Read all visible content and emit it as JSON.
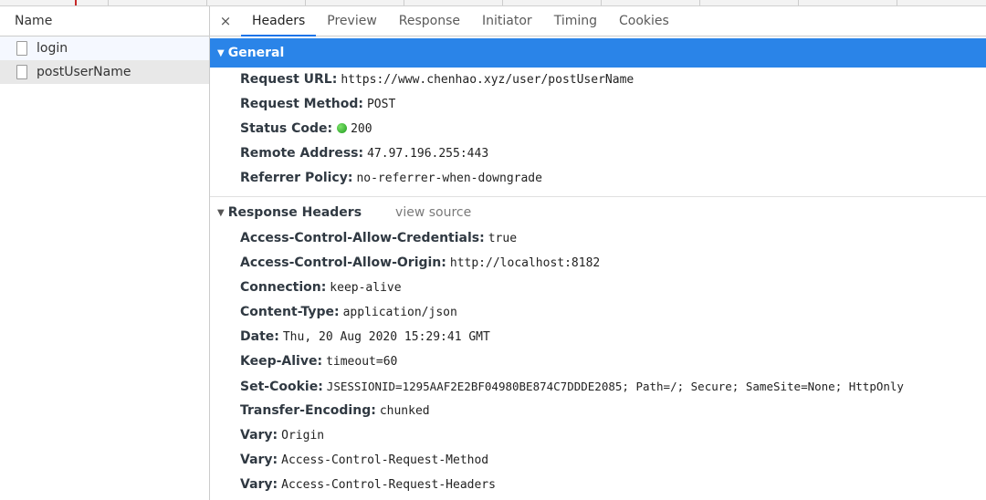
{
  "name_column": {
    "header": "Name"
  },
  "requests": [
    {
      "name": "login"
    },
    {
      "name": "postUserName"
    }
  ],
  "tabs": [
    {
      "label": "Headers"
    },
    {
      "label": "Preview"
    },
    {
      "label": "Response"
    },
    {
      "label": "Initiator"
    },
    {
      "label": "Timing"
    },
    {
      "label": "Cookies"
    }
  ],
  "close_symbol": "×",
  "general": {
    "title": "General",
    "rows": [
      {
        "key": "Request URL:",
        "value": "https://www.chenhao.xyz/user/postUserName"
      },
      {
        "key": "Request Method:",
        "value": "POST"
      },
      {
        "key": "Status Code:",
        "value": "200"
      },
      {
        "key": "Remote Address:",
        "value": "47.97.196.255:443"
      },
      {
        "key": "Referrer Policy:",
        "value": "no-referrer-when-downgrade"
      }
    ]
  },
  "response_headers": {
    "title": "Response Headers",
    "view_source": "view source",
    "rows": [
      {
        "key": "Access-Control-Allow-Credentials:",
        "value": "true"
      },
      {
        "key": "Access-Control-Allow-Origin:",
        "value": "http://localhost:8182"
      },
      {
        "key": "Connection:",
        "value": "keep-alive"
      },
      {
        "key": "Content-Type:",
        "value": "application/json"
      },
      {
        "key": "Date:",
        "value": "Thu, 20 Aug 2020 15:29:41 GMT"
      },
      {
        "key": "Keep-Alive:",
        "value": "timeout=60"
      },
      {
        "key": "Set-Cookie:",
        "value": "JSESSIONID=1295AAF2E2BF04980BE874C7DDDE2085; Path=/; Secure; SameSite=None; HttpOnly"
      },
      {
        "key": "Transfer-Encoding:",
        "value": "chunked"
      },
      {
        "key": "Vary:",
        "value": "Origin"
      },
      {
        "key": "Vary:",
        "value": "Access-Control-Request-Method"
      },
      {
        "key": "Vary:",
        "value": "Access-Control-Request-Headers"
      }
    ]
  },
  "colors": {
    "general_bar": "#2a84e8",
    "active_tab_underline": "#1a73e8",
    "status_ok": "#1e9b1e"
  }
}
